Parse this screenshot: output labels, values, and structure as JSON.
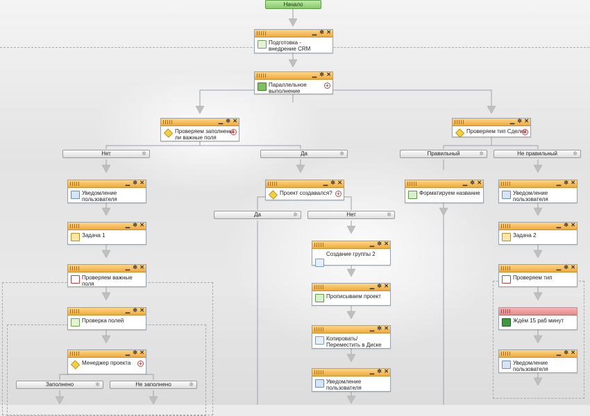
{
  "start": {
    "label": "Начало"
  },
  "activities": {
    "crm_prep": "Подготовка - внедрение CRM",
    "parallel": "Параллельное выполнение",
    "check_required": "Проверяем заполнены ли важные поля",
    "check_deal_type": "Проверяем тип Сделки",
    "notify_user_left": "Уведомление пользователя",
    "task_1": "Задача 1",
    "check_important_fields": "Проверяем важные поля",
    "check_fields": "Проверка полей",
    "project_manager": "Менеджер проекта",
    "project_created": "Проект создавался?",
    "create_group": "Создание группы 2",
    "write_project": "Прописываем проект",
    "copy_move_disk": "Копировать/Переместить в Диске",
    "notify_user_mid": "Уведомление пользователя",
    "format_name": "Форматируем название",
    "notify_user_right": "Уведомление пользователя",
    "task_2": "Задача 2",
    "check_type": "Проверяем тип",
    "wait_15": "Ждём 15 раб минут",
    "notify_user_right2": "Уведомление пользователя"
  },
  "branches": {
    "no": "Нет",
    "yes": "Да",
    "correct": "Правильный",
    "incorrect": "Не правильный",
    "yes2": "Да",
    "no2": "Нет",
    "filled": "Заполнено",
    "not_filled": "Не заполнено"
  },
  "colors": {
    "header_orange": "#f2aa3b",
    "header_red": "#e58a8a",
    "start_green": "#86c86a",
    "connector_gray": "#9aa2aa"
  },
  "icons": {
    "minimize": "minimize-icon",
    "settings": "gear-icon",
    "close": "close-icon",
    "add": "plus-icon"
  }
}
